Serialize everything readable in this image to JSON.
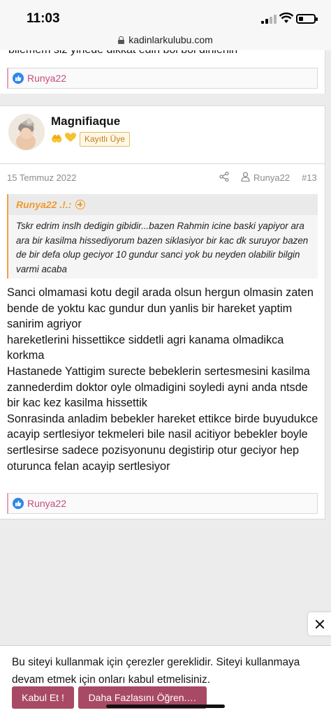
{
  "status_bar": {
    "time": "11:03",
    "battery_level": 0.3
  },
  "browser": {
    "url": "kadinlarkulubu.com"
  },
  "previous_post": {
    "cut_text": "bilemem siz yinede dikkat edin bol bol dinlenin",
    "reaction_user": "Runya22"
  },
  "post": {
    "username": "Magnifiaque",
    "badge": "Kayıtlı Üye",
    "date": "15 Temmuz 2022",
    "author_link": "Runya22",
    "number": "#13",
    "quote": {
      "author": "Runya22 .!.:",
      "text": "Tskr edrim inslh dedigin gibidir...bazen Rahmin icine baski yapiyor ara ara bir kasilma hissediyorum bazen siklasiyor bir kac dk suruyor bazen de bir defa olup geciyor 10 gundur sanci yok bu neyden olabilir bilgin varmi acaba"
    },
    "body": "Sanci olmamasi kotu degil arada olsun hergun olmasin zaten bende de yoktu kac gundur dun yanlis bir hareket yaptim sanirim agriyor\nhareketlerini hissettikce siddetli agri kanama olmadikca korkma\nHastanede Yattigim surecte bebeklerin sertesmesini kasilma zannederdim doktor oyle olmadigini soyledi ayni anda ntsde bir kac kez kasilma hissettik\nSonrasinda anladim bebekler hareket ettikce birde buyudukce acayip sertlesiyor tekmeleri bile nasil acitiyor bebekler boyle sertlesirse sadece pozisyonunu degistirip otur geciyor hep oturunca felan acayip sertlesiyor",
    "reaction_user": "Runya22"
  },
  "cookie_notice": {
    "text": "Bu siteyi kullanmak için çerezler gereklidir. Siteyi kullanmaya devam etmek için onları kabul etmelisiniz.",
    "accept_label": "Kabul Et !",
    "learn_more_label": "Daha Fazlasını Öğren.…"
  },
  "colors": {
    "accent_pink": "#c54b7e",
    "quote_orange": "#f09a2c",
    "button": "#a84a65",
    "like_blue": "#2e87e8"
  }
}
